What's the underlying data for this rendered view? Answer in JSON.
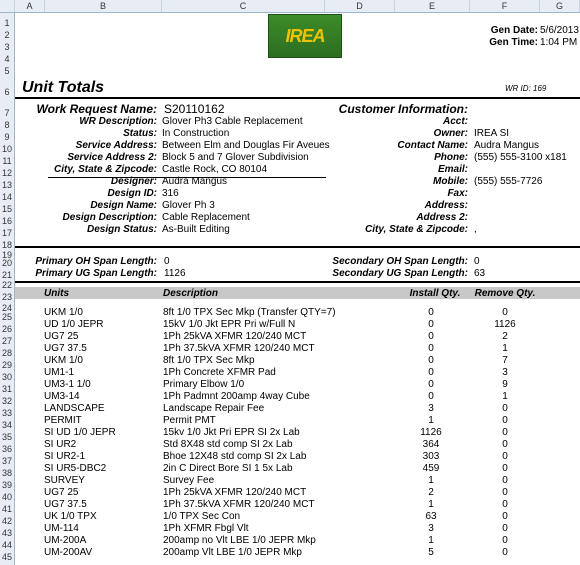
{
  "columns": [
    "A",
    "B",
    "C",
    "D",
    "E",
    "F",
    "G"
  ],
  "rows": [
    "1",
    "2",
    "3",
    "4",
    "5",
    "6",
    "7",
    "8",
    "9",
    "10",
    "11",
    "12",
    "13",
    "14",
    "15",
    "16",
    "17",
    "18",
    "19",
    "20",
    "21",
    "22",
    "23",
    "24",
    "25",
    "26",
    "27",
    "28",
    "29",
    "30",
    "31",
    "32",
    "33",
    "34",
    "35",
    "36",
    "37",
    "38",
    "39",
    "40",
    "41",
    "42",
    "43",
    "44",
    "45"
  ],
  "logo_text": "IREA",
  "gen": {
    "date_label": "Gen Date:",
    "date_value": "5/6/2013",
    "time_label": "Gen Time:",
    "time_value": "1:04 PM"
  },
  "title": "Unit Totals",
  "wr_id": "WR ID: 169",
  "work_request": {
    "label": "Work Request Name:",
    "value": "S20110162"
  },
  "customer_info_label": "Customer Information:",
  "left_fields": [
    {
      "label": "WR Description:",
      "value": "Glover Ph3 Cable Replacement"
    },
    {
      "label": "Status:",
      "value": "In Construction"
    },
    {
      "label": "Service Address:",
      "value": "Between Elm and Douglas Fir Aveues"
    },
    {
      "label": "Service Address 2:",
      "value": "Block 5 and 7 Glover Subdivision"
    },
    {
      "label": "City, State & Zipcode:",
      "value": "Castle Rock, CO 80104"
    },
    {
      "label": "Designer:",
      "value": "Audra Mangus"
    },
    {
      "label": "Design ID:",
      "value": "316"
    },
    {
      "label": "Design Name:",
      "value": "Glover Ph 3"
    },
    {
      "label": "Design Description:",
      "value": "Cable Replacement"
    },
    {
      "label": "Design Status:",
      "value": "As-Built Editing"
    }
  ],
  "right_fields": [
    {
      "label": "Acct:",
      "value": ""
    },
    {
      "label": "Owner:",
      "value": "IREA SI"
    },
    {
      "label": "Contact Name:",
      "value": "Audra Mangus"
    },
    {
      "label": "Phone:",
      "value": "(555) 555-3100 x181"
    },
    {
      "label": "Email:",
      "value": ""
    },
    {
      "label": "Mobile:",
      "value": "(555) 555-7726"
    },
    {
      "label": "Fax:",
      "value": ""
    },
    {
      "label": "Address:",
      "value": ""
    },
    {
      "label": "Address 2:",
      "value": ""
    },
    {
      "label": "City, State & Zipcode:",
      "value": ","
    }
  ],
  "span": {
    "p_oh_label": "Primary OH Span Length:",
    "p_oh_value": "0",
    "p_ug_label": "Primary UG Span Length:",
    "p_ug_value": "1126",
    "s_oh_label": "Secondary OH Span Length:",
    "s_oh_value": "0",
    "s_ug_label": "Secondary UG Span Length:",
    "s_ug_value": "63"
  },
  "table": {
    "headers": {
      "units": "Units",
      "description": "Description",
      "install": "Install Qty.",
      "remove": "Remove Qty."
    },
    "rows": [
      {
        "unit": "UKM 1/0",
        "desc": "8ft 1/0 TPX Sec Mkp  (Transfer QTY=7)",
        "install": "0",
        "remove": "0"
      },
      {
        "unit": "UD 1/0 JEPR",
        "desc": "15kV 1/0 Jkt EPR Pri w/Full N",
        "install": "0",
        "remove": "1126"
      },
      {
        "unit": "UG7 25",
        "desc": "1Ph 25kVA XFMR 120/240 MCT",
        "install": "0",
        "remove": "2"
      },
      {
        "unit": "UG7 37.5",
        "desc": "1Ph 37.5kVA XFMR 120/240 MCT",
        "install": "0",
        "remove": "1"
      },
      {
        "unit": "UKM 1/0",
        "desc": "8ft 1/0 TPX Sec Mkp",
        "install": "0",
        "remove": "7"
      },
      {
        "unit": "UM1-1",
        "desc": "1Ph Concrete XFMR Pad",
        "install": "0",
        "remove": "3"
      },
      {
        "unit": "UM3-1 1/0",
        "desc": "Primary Elbow 1/0",
        "install": "0",
        "remove": "9"
      },
      {
        "unit": "UM3-14",
        "desc": "1Ph Padmnt 200amp 4way Cube",
        "install": "0",
        "remove": "1"
      },
      {
        "unit": "LANDSCAPE",
        "desc": "Landscape Repair Fee",
        "install": "3",
        "remove": "0"
      },
      {
        "unit": "PERMIT",
        "desc": "Permit PMT",
        "install": "1",
        "remove": "0"
      },
      {
        "unit": "SI UD 1/0 JEPR",
        "desc": "15kv 1/0 Jkt Pri EPR SI 2x Lab",
        "install": "1126",
        "remove": "0"
      },
      {
        "unit": "SI UR2",
        "desc": "Std 8X48 std comp SI 2x Lab",
        "install": "364",
        "remove": "0"
      },
      {
        "unit": "SI UR2-1",
        "desc": "Bhoe 12X48 std comp SI 2x Lab",
        "install": "303",
        "remove": "0"
      },
      {
        "unit": "SI UR5-DBC2",
        "desc": "2in C Direct Bore SI 1 5x Lab",
        "install": "459",
        "remove": "0"
      },
      {
        "unit": "SURVEY",
        "desc": "Survey Fee",
        "install": "1",
        "remove": "0"
      },
      {
        "unit": "UG7 25",
        "desc": "1Ph 25kVA XFMR 120/240 MCT",
        "install": "2",
        "remove": "0"
      },
      {
        "unit": "UG7 37.5",
        "desc": "1Ph 37.5kVA XFMR 120/240 MCT",
        "install": "1",
        "remove": "0"
      },
      {
        "unit": "UK 1/0 TPX",
        "desc": "1/0 TPX Sec Con",
        "install": "63",
        "remove": "0"
      },
      {
        "unit": "UM-114",
        "desc": "1Ph XFMR Fbgl Vlt",
        "install": "3",
        "remove": "0"
      },
      {
        "unit": "UM-200A",
        "desc": "200amp no Vlt LBE 1/0 JEPR Mkp",
        "install": "1",
        "remove": "0"
      },
      {
        "unit": "UM-200AV",
        "desc": "200amp Vlt LBE 1/0 JEPR Mkp",
        "install": "5",
        "remove": "0"
      }
    ]
  }
}
